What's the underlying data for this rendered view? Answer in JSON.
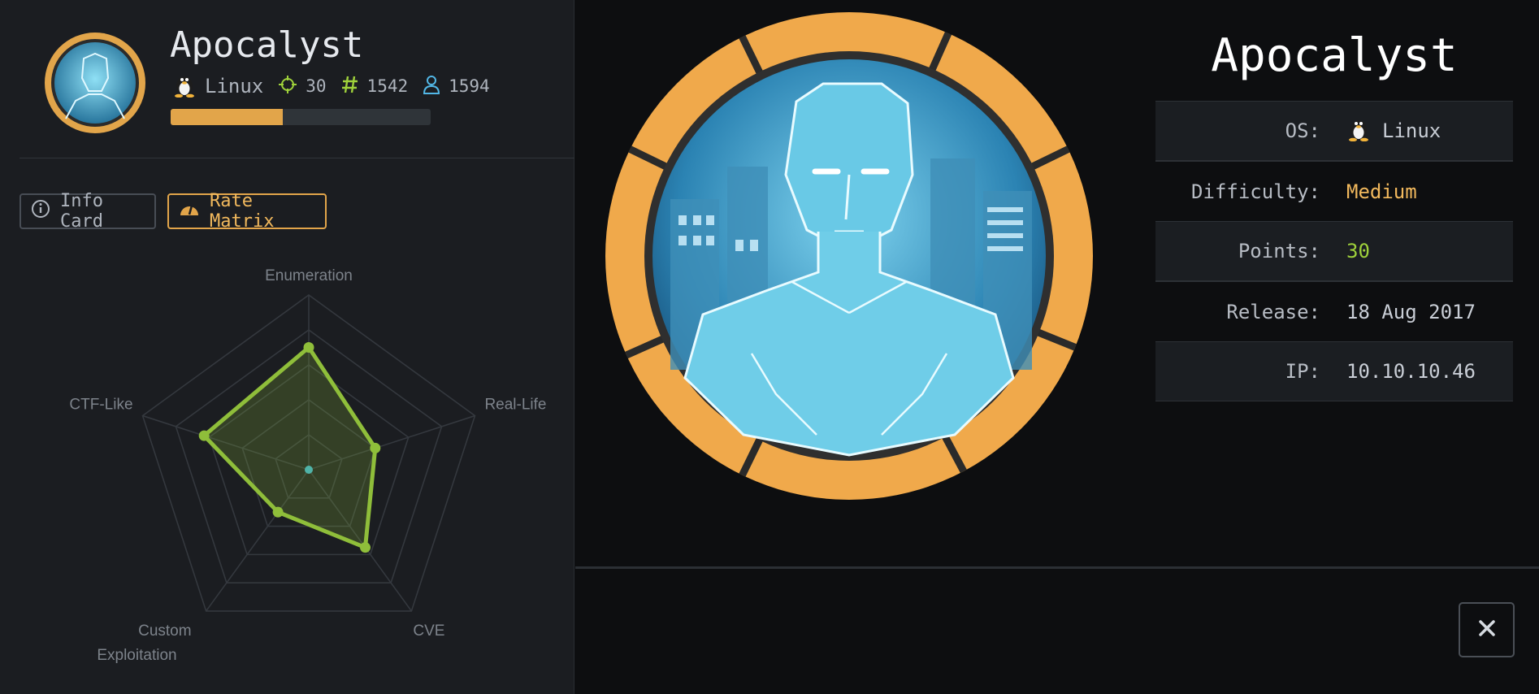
{
  "header": {
    "title": "Apocalyst",
    "os": "Linux",
    "points": "30",
    "user_owns": "1542",
    "system_owns": "1594",
    "progress": 0.43
  },
  "tabs": [
    {
      "label": "Info Card",
      "icon": "info-icon",
      "active": false
    },
    {
      "label": "Rate Matrix",
      "icon": "gauge-icon",
      "active": true
    }
  ],
  "chart_data": {
    "type": "radar",
    "categories": [
      "Enumeration",
      "Real-Life",
      "CVE",
      "Custom Exploitation",
      "CTF-Like"
    ],
    "max": 10,
    "rings": 5,
    "values": [
      7.0,
      4.0,
      5.5,
      3.0,
      6.3
    ],
    "color": "#8fbe3a"
  },
  "info_card": {
    "title": "Apocalyst",
    "rows": [
      {
        "label": "OS:",
        "value": "Linux"
      },
      {
        "label": "Difficulty:",
        "value": "Medium"
      },
      {
        "label": "Points:",
        "value": "30"
      },
      {
        "label": "Release:",
        "value": "18 Aug 2017"
      },
      {
        "label": "IP:",
        "value": "10.10.10.46"
      }
    ]
  },
  "colors": {
    "accent": "#e2a54a",
    "difficulty_medium": "#f2b95d",
    "points_green": "#9fd13b",
    "panel": "#1b1d21",
    "background": "#0d0e10"
  },
  "icons": {
    "close": "close-icon",
    "os": "linux-penguin-icon",
    "points": "crosshair-icon",
    "user_owns": "hash-icon",
    "system_owns": "user-icon"
  }
}
